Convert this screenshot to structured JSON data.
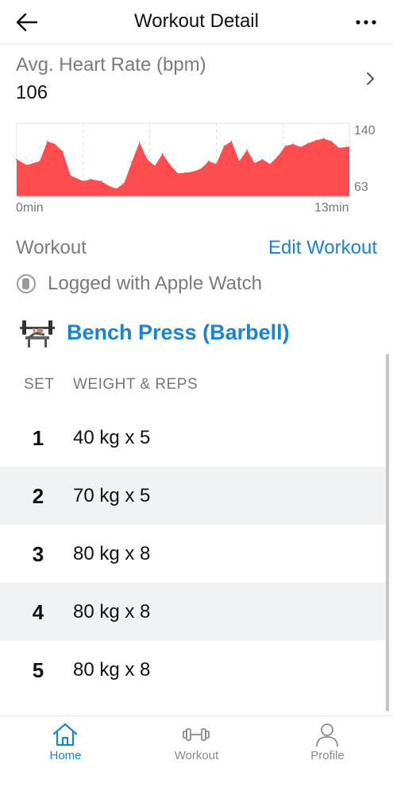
{
  "header": {
    "title": "Workout Detail"
  },
  "heart_rate": {
    "title": "Avg. Heart Rate (bpm)",
    "value": "106",
    "y_max_label": "140",
    "y_min_label": "63",
    "x_start_label": "0min",
    "x_end_label": "13min",
    "fill_color": "#ff4d4f"
  },
  "chart_data": {
    "type": "area",
    "x": [
      0,
      0.4,
      0.9,
      1.2,
      1.5,
      1.8,
      2.1,
      2.6,
      2.9,
      3.3,
      3.6,
      3.9,
      4.2,
      4.5,
      4.8,
      5.1,
      5.4,
      5.7,
      6.0,
      6.3,
      6.6,
      6.9,
      7.2,
      7.5,
      7.8,
      8.1,
      8.4,
      8.7,
      9.0,
      9.3,
      9.6,
      9.9,
      10.2,
      10.5,
      10.8,
      11.1,
      11.4,
      11.7,
      12.0,
      12.3,
      12.6,
      12.9,
      13.0
    ],
    "y": [
      102,
      96,
      100,
      121,
      118,
      110,
      85,
      79,
      81,
      79,
      74,
      71,
      77,
      99,
      120,
      102,
      95,
      108,
      96,
      87,
      88,
      89,
      92,
      100,
      97,
      116,
      121,
      100,
      112,
      98,
      102,
      97,
      105,
      116,
      118,
      115,
      119,
      122,
      124,
      121,
      114,
      115,
      115
    ],
    "xlabel": "",
    "ylabel": "",
    "xlim": [
      0,
      13
    ],
    "ylim": [
      63,
      140
    ],
    "grid": true
  },
  "workout": {
    "section_title": "Workout",
    "edit_label": "Edit Workout",
    "logged_text": "Logged with Apple Watch",
    "exercise_name": "Bench Press (Barbell)",
    "col_set": "SET",
    "col_weight": "WEIGHT & REPS",
    "sets": [
      {
        "num": "1",
        "value": "40 kg x 5"
      },
      {
        "num": "2",
        "value": "70 kg x 5"
      },
      {
        "num": "3",
        "value": "80 kg x 8"
      },
      {
        "num": "4",
        "value": "80 kg x 8"
      },
      {
        "num": "5",
        "value": "80 kg x 8"
      }
    ]
  },
  "tabbar": {
    "items": [
      {
        "label": "Home",
        "icon": "home-icon",
        "active": true
      },
      {
        "label": "Workout",
        "icon": "dumbbell-icon",
        "active": false
      },
      {
        "label": "Profile",
        "icon": "profile-icon",
        "active": false
      }
    ],
    "active_color": "#1a83d6"
  }
}
